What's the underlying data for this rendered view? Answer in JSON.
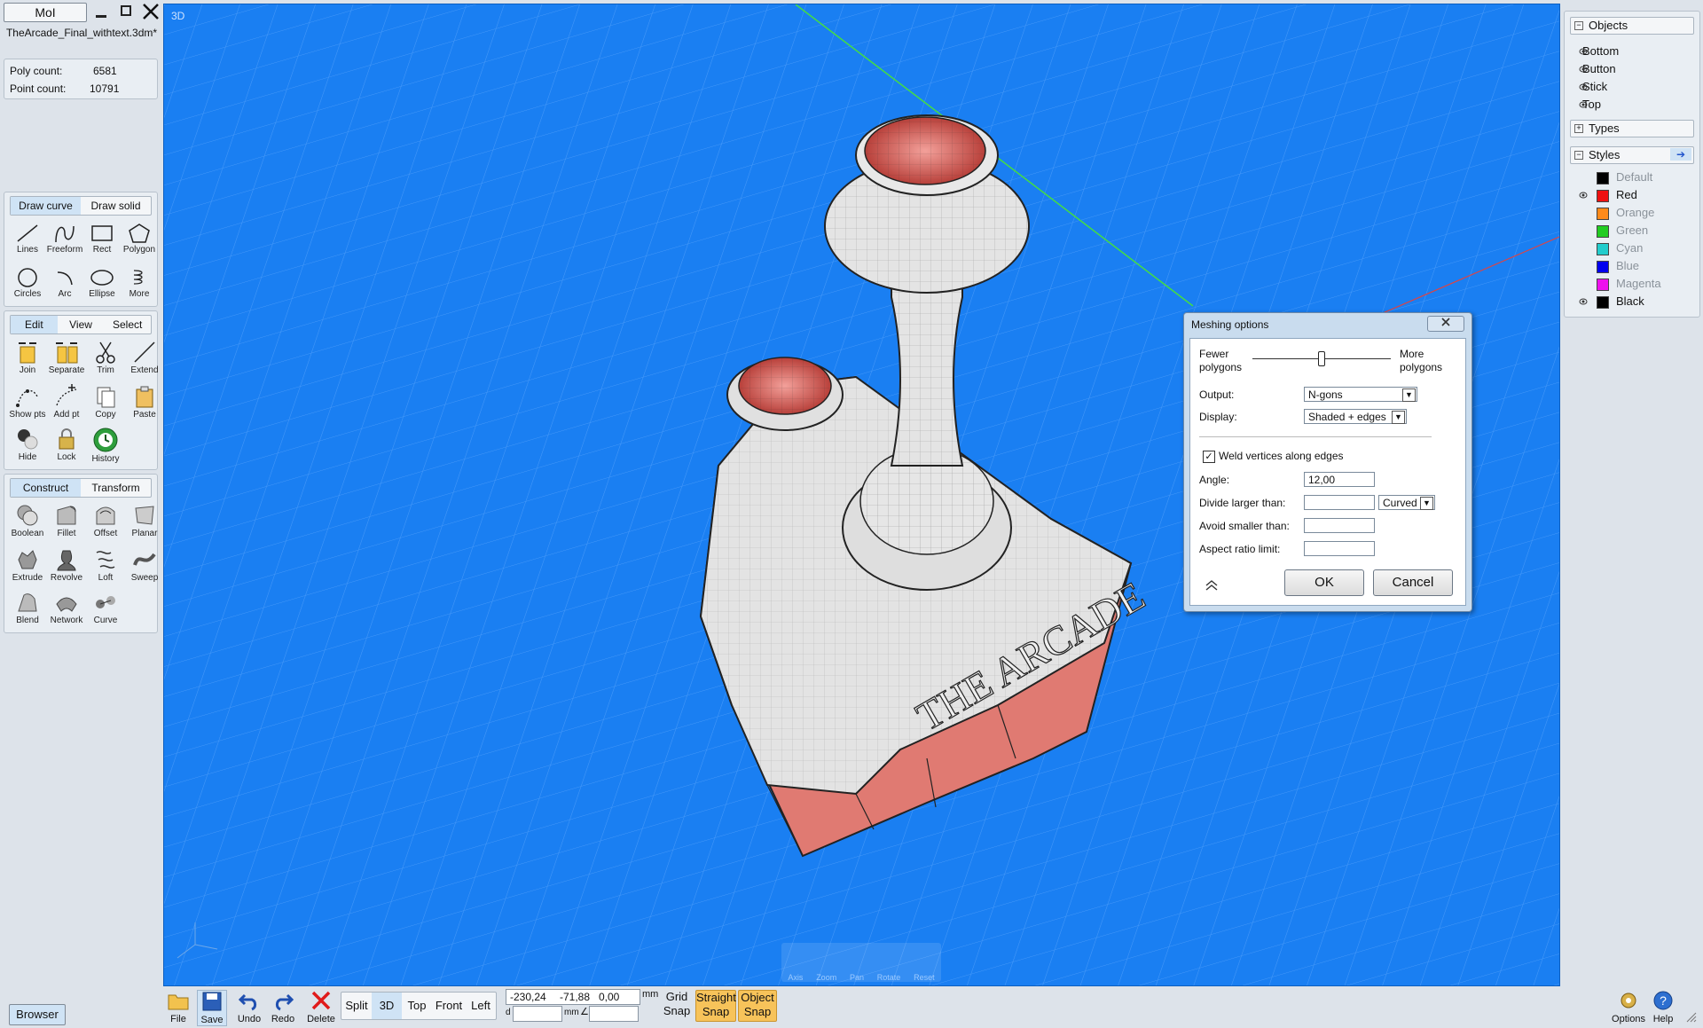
{
  "app": {
    "name": "MoI",
    "file": "TheArcade_Final_withtext.3dm*",
    "viewport_label": "3D"
  },
  "stats": {
    "poly_label": "Poly count:",
    "poly_value": "6581",
    "point_label": "Point count:",
    "point_value": "10791"
  },
  "draw": {
    "tabs": [
      "Draw curve",
      "Draw solid"
    ],
    "tools": [
      "Lines",
      "Freeform",
      "Rect",
      "Polygon",
      "Circles",
      "Arc",
      "Ellipse",
      "More"
    ]
  },
  "edit": {
    "tabs": [
      "Edit",
      "View",
      "Select"
    ],
    "tools": [
      "Join",
      "Separate",
      "Trim",
      "Extend",
      "Show pts",
      "Add pt",
      "Copy",
      "Paste",
      "Hide",
      "Lock",
      "History"
    ]
  },
  "construct": {
    "tabs": [
      "Construct",
      "Transform"
    ],
    "tools": [
      "Boolean",
      "Fillet",
      "Offset",
      "Planar",
      "Extrude",
      "Revolve",
      "Loft",
      "Sweep",
      "Blend",
      "Network",
      "Curve"
    ]
  },
  "browser_button": "Browser",
  "scene_text": "THE ARCADE",
  "nav_overlay": [
    "Axis",
    "Zoom",
    "Pan",
    "Rotate",
    "Reset"
  ],
  "objects": {
    "title": "Objects",
    "items": [
      "Bottom",
      "Button",
      "Stick",
      "Top"
    ],
    "types_title": "Types"
  },
  "styles": {
    "title": "Styles",
    "items": [
      {
        "name": "Default",
        "color": "#000000",
        "active": false,
        "eye": false
      },
      {
        "name": "Red",
        "color": "#ee1111",
        "active": true,
        "eye": true
      },
      {
        "name": "Orange",
        "color": "#ff8a1a",
        "active": false,
        "eye": false
      },
      {
        "name": "Green",
        "color": "#22cc22",
        "active": false,
        "eye": false
      },
      {
        "name": "Cyan",
        "color": "#22cccc",
        "active": false,
        "eye": false
      },
      {
        "name": "Blue",
        "color": "#0000ee",
        "active": false,
        "eye": false
      },
      {
        "name": "Magenta",
        "color": "#ee11ee",
        "active": false,
        "eye": false
      },
      {
        "name": "Black",
        "color": "#000000",
        "active": true,
        "eye": true
      }
    ]
  },
  "dialog": {
    "title": "Meshing options",
    "fewer": "Fewer polygons",
    "more": "More polygons",
    "slider_fraction": 0.5,
    "output_label": "Output:",
    "output_value": "N-gons",
    "display_label": "Display:",
    "display_value": "Shaded + edges",
    "weld_label": "Weld vertices along edges",
    "weld_checked": true,
    "angle_label": "Angle:",
    "angle_value": "12,00",
    "divide_label": "Divide larger than:",
    "divide_value": "",
    "divide_mode": "Curved",
    "avoid_label": "Avoid smaller than:",
    "avoid_value": "",
    "aspect_label": "Aspect ratio limit:",
    "aspect_value": "",
    "ok": "OK",
    "cancel": "Cancel"
  },
  "bottom": {
    "file": "File",
    "save": "Save",
    "undo": "Undo",
    "redo": "Redo",
    "delete": "Delete",
    "views": [
      "Split",
      "3D",
      "Top",
      "Front",
      "Left"
    ],
    "coord_x": "-230,24",
    "coord_y": "-71,88",
    "coord_z": "0,00",
    "unit": "mm",
    "d_label": "d",
    "d_unit": "mm",
    "grid_snap": "Grid Snap",
    "straight_snap": "Straight Snap",
    "object_snap": "Object Snap",
    "options": "Options",
    "help": "Help"
  },
  "colors": {
    "viewport": "#1a7ff2",
    "snap_on": "#f7c35a",
    "mesh_red": "#e07a72"
  }
}
